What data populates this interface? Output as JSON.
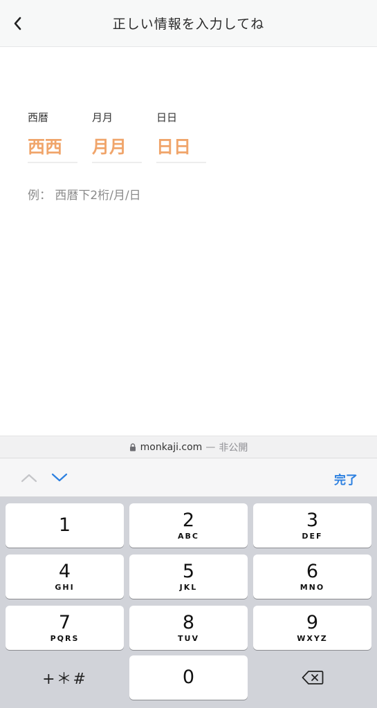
{
  "header": {
    "back_icon": "chevron-left-icon",
    "title": "正しい情報を入力してね"
  },
  "form": {
    "fields": [
      {
        "label": "西暦",
        "placeholder": "西西"
      },
      {
        "label": "月月",
        "placeholder": "月月"
      },
      {
        "label": "日日",
        "placeholder": "日日"
      }
    ],
    "example": "例： 西暦下2桁/月/日",
    "accent_color": "#f0a56b"
  },
  "browser": {
    "lock_icon": "lock-icon",
    "host": "monkaji.com",
    "separator": "—",
    "note": "非公開"
  },
  "accessory_bar": {
    "prev_icon": "chevron-up-icon",
    "next_icon": "chevron-down-icon",
    "done_label": "完了",
    "accent_color": "#2b7fe0"
  },
  "keypad": {
    "keys": [
      {
        "num": "1",
        "letters": ""
      },
      {
        "num": "2",
        "letters": "ABC"
      },
      {
        "num": "3",
        "letters": "DEF"
      },
      {
        "num": "4",
        "letters": "GHI"
      },
      {
        "num": "5",
        "letters": "JKL"
      },
      {
        "num": "6",
        "letters": "MNO"
      },
      {
        "num": "7",
        "letters": "PQRS"
      },
      {
        "num": "8",
        "letters": "TUV"
      },
      {
        "num": "9",
        "letters": "WXYZ"
      }
    ],
    "symbols_label": "+＊#",
    "zero": "0",
    "delete_icon": "backspace-icon"
  }
}
